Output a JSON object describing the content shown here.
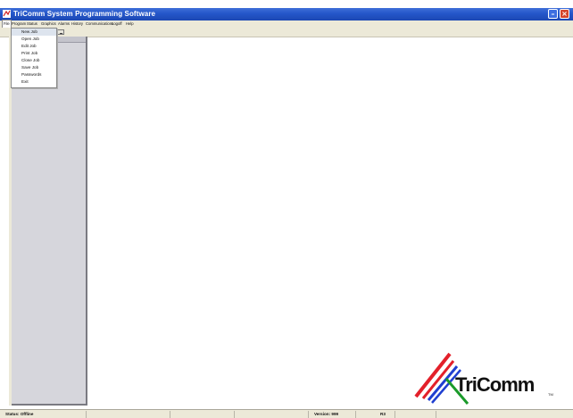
{
  "window": {
    "title": "TriComm System Programming Software",
    "title_bar_color": "#2456c9",
    "minimize_glyph": "–",
    "close_glyph": "×"
  },
  "menubar": {
    "items": [
      "File",
      "Program",
      "Status",
      "Graphics",
      "Alarms",
      "History",
      "Communications",
      "Logoff",
      "Help"
    ],
    "active": "File"
  },
  "file_menu": {
    "items": [
      "New Job",
      "Open Job",
      "Edit Job",
      "Print Job",
      "Close Job",
      "Save Job",
      "Passwords",
      "Exit"
    ],
    "highlighted": "New Job"
  },
  "statusbar": {
    "status": "Status: Offline",
    "version": "Version: 999",
    "ready": "R3"
  },
  "logo": {
    "text": "TriComm",
    "trademark": "TM",
    "colors": {
      "red": "#e3202a",
      "blue": "#1f3fd0",
      "green": "#1a9a2a"
    }
  },
  "icons": {
    "app": "app-icon",
    "toolbar_button": "toolbar-button-icon"
  }
}
